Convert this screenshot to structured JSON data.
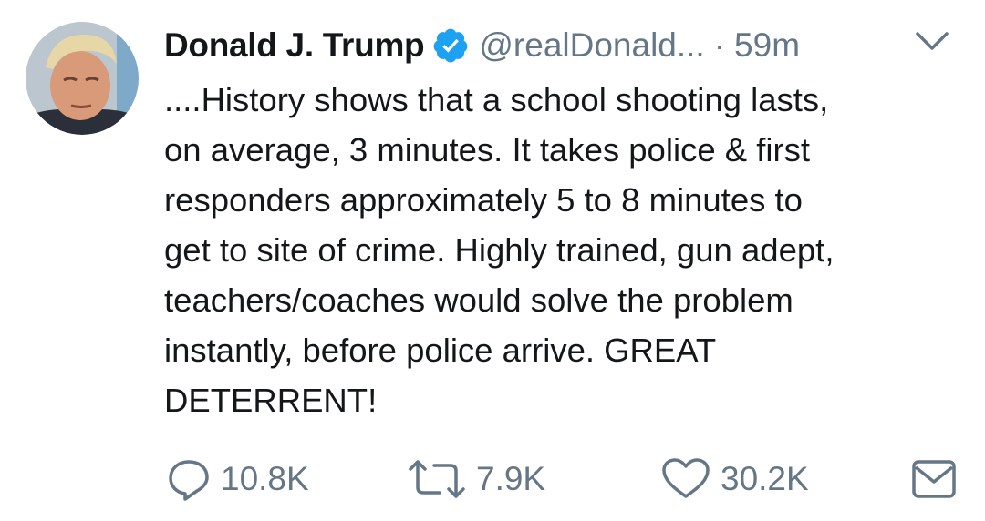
{
  "tweet": {
    "author_name": "Donald J. Trump",
    "handle": "@realDonald...",
    "separator": "·",
    "time": "59m",
    "text_lines": [
      "....History shows that a school shooting lasts,",
      "on average, 3 minutes. It takes police & first",
      "responders approximately 5 to 8 minutes to",
      "get to site of crime. Highly trained, gun adept,",
      "teachers/coaches would solve the problem",
      "instantly, before police arrive. GREAT",
      "DETERRENT!"
    ]
  },
  "actions": {
    "replies": "10.8K",
    "retweets": "7.9K",
    "likes": "30.2K"
  },
  "icons": {
    "verified": "verified-badge-icon",
    "more": "chevron-down-icon",
    "reply": "reply-icon",
    "retweet": "retweet-icon",
    "like": "heart-icon",
    "dm": "envelope-icon"
  },
  "colors": {
    "text": "#14171a",
    "secondary": "#657786",
    "verified_blue": "#1da1f2"
  }
}
